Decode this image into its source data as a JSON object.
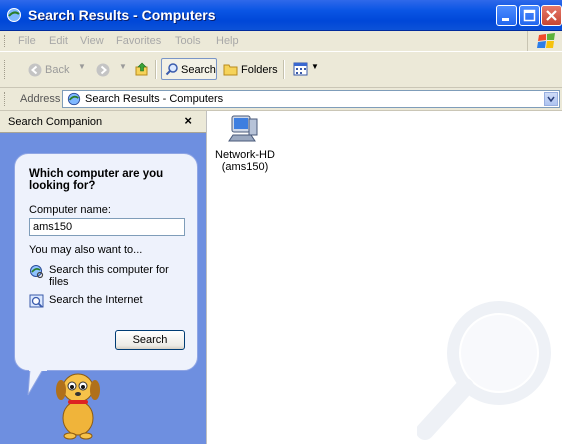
{
  "window": {
    "title": "Search Results - Computers"
  },
  "menu": {
    "items": [
      "File",
      "Edit",
      "View",
      "Favorites",
      "Tools",
      "Help"
    ]
  },
  "toolbar": {
    "back": "Back",
    "search": "Search",
    "folders": "Folders"
  },
  "address": {
    "label": "Address",
    "value": "Search Results - Computers"
  },
  "companion": {
    "header": "Search Companion",
    "close": "×",
    "question": "Which computer are you looking for?",
    "computer_name_label": "Computer name:",
    "computer_name_value": "ams150",
    "also_label": "You may also want to...",
    "option1": "Search this computer for files",
    "option2": "Search the Internet",
    "search_button": "Search"
  },
  "results": {
    "items": [
      {
        "name": "Network-HD",
        "detail": "(ams150)"
      }
    ]
  },
  "icons": [
    "search-window-icon",
    "minimize-icon",
    "maximize-icon",
    "close-icon",
    "windows-logo-icon",
    "back-arrow-icon",
    "forward-arrow-icon",
    "up-folder-icon",
    "search-icon",
    "folders-icon",
    "views-icon",
    "computer-icon",
    "search-files-icon",
    "search-internet-icon",
    "dog-icon",
    "magnifier-watermark-icon"
  ],
  "colors": {
    "titlebar": "#0a55e4",
    "pane_bg": "#6e8fe0",
    "balloon_bg": "#eef2fc",
    "chrome": "#ece9d8"
  }
}
